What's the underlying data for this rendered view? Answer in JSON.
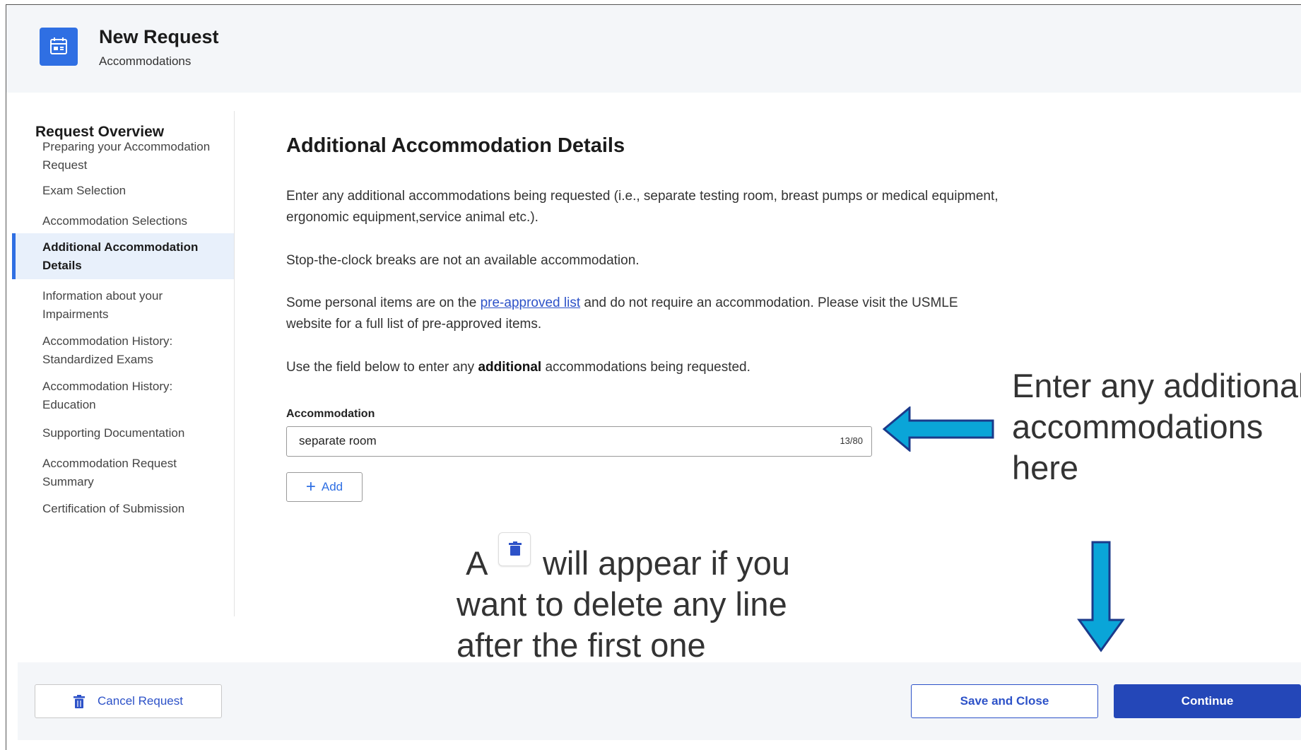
{
  "header": {
    "title": "New Request",
    "subtitle": "Accommodations",
    "icon": "calendar-icon"
  },
  "sidebar": {
    "title": "Request Overview",
    "items": [
      {
        "label": "Preparing your Accommodation Request",
        "active": false
      },
      {
        "label": "Exam Selection",
        "active": false
      },
      {
        "label": "Accommodation Selections",
        "active": false
      },
      {
        "label": "Additional Accommodation Details",
        "active": true
      },
      {
        "label": "Information about your Impairments",
        "active": false
      },
      {
        "label": "Accommodation History: Standardized Exams",
        "active": false
      },
      {
        "label": "Accommodation History: Education",
        "active": false
      },
      {
        "label": "Supporting Documentation",
        "active": false
      },
      {
        "label": "Accommodation Request Summary",
        "active": false
      },
      {
        "label": "Certification of Submission",
        "active": false
      }
    ]
  },
  "main": {
    "title": "Additional Accommodation Details",
    "para1": "Enter any additional accommodations being requested (i.e., separate testing room, breast pumps or medical equipment, ergonomic equipment,service animal etc.).",
    "para2": "Stop-the-clock breaks are not an available accommodation.",
    "para3_before": "Some personal items are on the ",
    "para3_link": "pre-approved list",
    "para3_after": " and do not require an accommodation. Please visit the USMLE website for a full list of pre-approved items.",
    "para4_before": "Use the field below to enter any ",
    "para4_bold": "additional",
    "para4_after": " accommodations being requested.",
    "field_label": "Accommodation",
    "field_value": "separate room",
    "counter": "13/80",
    "add_label": "Add"
  },
  "annotations": {
    "right": "Enter any additional accommodations here",
    "bottom_before": "A",
    "bottom_after": "will appear if you want to delete any line after the first one"
  },
  "footer": {
    "cancel_label": "Cancel Request",
    "save_label": "Save and Close",
    "continue_label": "Continue"
  },
  "colors": {
    "accent": "#2f6fe3",
    "primary_button": "#2447b8",
    "link": "#2d52c8",
    "arrow": "#0aa5d8"
  }
}
